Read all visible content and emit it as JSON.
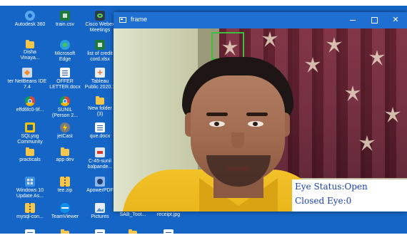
{
  "desktop": {
    "icons": [
      {
        "label": "Autodesk 360",
        "icon": "gear-icon"
      },
      {
        "label": "train.csv",
        "icon": "excel-file-icon"
      },
      {
        "label": "Cisco Webex\nMeetings",
        "icon": "webex-icon"
      },
      {
        "label": "Disha\nVinaya...",
        "icon": "folder-icon"
      },
      {
        "label": "Microsoft\nEdge",
        "icon": "edge-icon"
      },
      {
        "label": "list of credit\ncord.xlsx",
        "icon": "excel-file-icon"
      },
      {
        "label": "ter NetBeans IDE\n7.4",
        "icon": "netbeans-icon"
      },
      {
        "label": "OFFER\nLETTER.docx",
        "icon": "word-file-icon"
      },
      {
        "label": "Tableau\nPublic 2020.1",
        "icon": "tableau-icon"
      },
      {
        "label": "effd6fc0-9f...",
        "icon": "chrome-icon"
      },
      {
        "label": "SUNIL\n(Person 2...",
        "icon": "chrome-icon"
      },
      {
        "label": "New folder\n(3)",
        "icon": "folder-icon"
      },
      {
        "label": "SQLyog\nCommunity",
        "icon": "sqlyog-icon"
      },
      {
        "label": "jetCast",
        "icon": "jetcast-icon"
      },
      {
        "label": "que.docx",
        "icon": "word-file-icon"
      },
      {
        "label": "practicals",
        "icon": "folder-icon"
      },
      {
        "label": "app dev",
        "icon": "folder-icon"
      },
      {
        "label": "C-45-sunil\nbalpande...",
        "icon": "pdf-file-icon"
      },
      {
        "label": "Windows 10\nUpdate As...",
        "icon": "windows-update-icon"
      },
      {
        "label": "tee.zip",
        "icon": "zip-file-icon"
      },
      {
        "label": "ApowerPDF",
        "icon": "pdf-app-icon"
      },
      {
        "label": "mysql-con...",
        "icon": "zip-file-icon"
      },
      {
        "label": "TeamViewer",
        "icon": "teamviewer-icon"
      },
      {
        "label": "Pictures",
        "icon": "image-icon"
      },
      {
        "label": "SAB_Toot...",
        "icon": "image-icon"
      },
      {
        "label": "receipt.jpg",
        "icon": "image-icon"
      }
    ]
  },
  "window": {
    "title": "frame",
    "minimize": "",
    "maximize": "",
    "close": "✕"
  },
  "overlay": {
    "eye_status": "Eye Status:Open",
    "closed_eye": "Closed Eye:0"
  },
  "colors": {
    "desktop_bg": "#1565c6",
    "title_bar": "#1e6fd1",
    "face_box": "#3fbf3f",
    "overlay_text": "#1a3fb0"
  }
}
